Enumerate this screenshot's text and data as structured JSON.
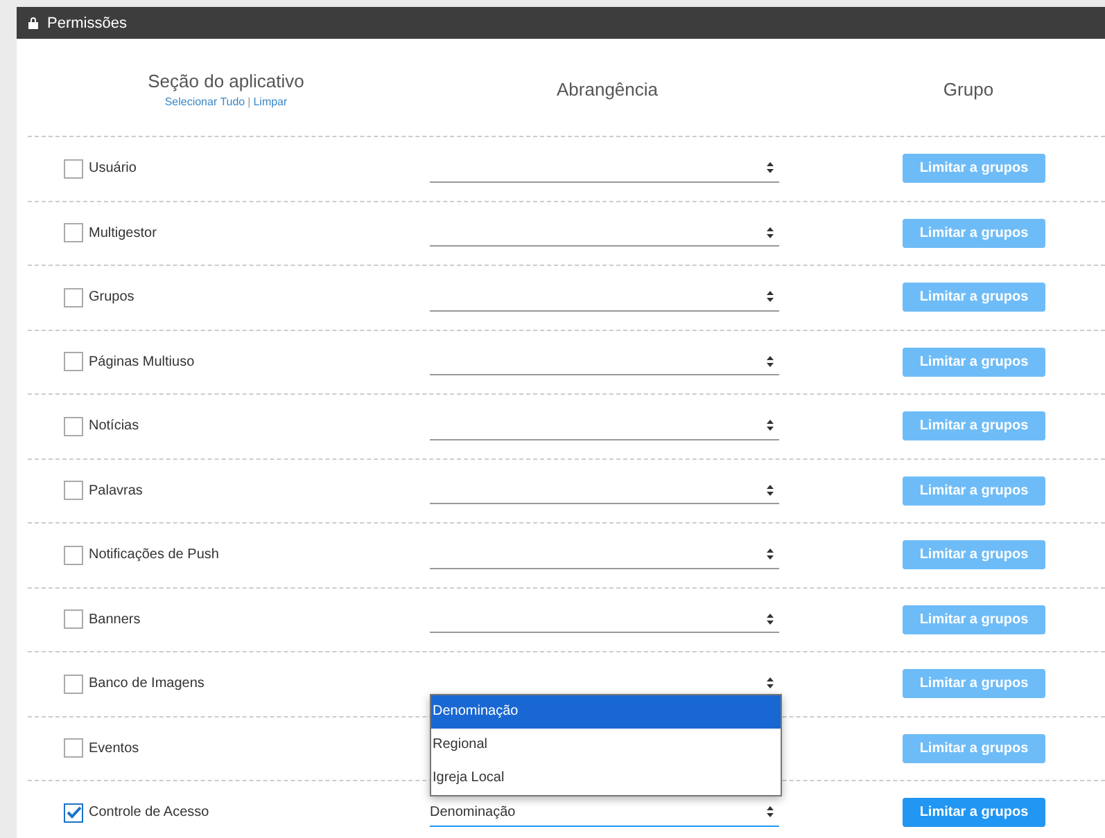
{
  "panel": {
    "title": "Permissões"
  },
  "columns": [
    "Seção do aplicativo",
    "Abrangência",
    "Grupo"
  ],
  "select_links": [
    "Selecionar Tudo",
    "Limpar"
  ],
  "link_separator": "|",
  "rows": [
    {
      "section": "Usuário",
      "checked": false,
      "scope": "",
      "button": "Limitar a grupos",
      "disabled": true
    },
    {
      "section": "Multigestor",
      "checked": false,
      "scope": "",
      "button": "Limitar a grupos",
      "disabled": true
    },
    {
      "section": "Grupos",
      "checked": false,
      "scope": "",
      "button": "Limitar a grupos",
      "disabled": true
    },
    {
      "section": "Páginas Multiuso",
      "checked": false,
      "scope": "",
      "button": "Limitar a grupos",
      "disabled": true
    },
    {
      "section": "Notícias",
      "checked": false,
      "scope": "",
      "button": "Limitar a grupos",
      "disabled": true
    },
    {
      "section": "Palavras",
      "checked": false,
      "scope": "",
      "button": "Limitar a grupos",
      "disabled": true
    },
    {
      "section": "Notificações de Push",
      "checked": false,
      "scope": "",
      "button": "Limitar a grupos",
      "disabled": true
    },
    {
      "section": "Banners",
      "checked": false,
      "scope": "",
      "button": "Limitar a grupos",
      "disabled": true
    },
    {
      "section": "Banco de Imagens",
      "checked": false,
      "scope": "",
      "button": "Limitar a grupos",
      "disabled": true
    },
    {
      "section": "Eventos",
      "checked": false,
      "button": "Limitar a grupos",
      "disabled": true,
      "select_covered": true
    },
    {
      "section": "Controle de Acesso",
      "checked": true,
      "scope": "Denominação",
      "button": "Limitar a grupos",
      "disabled": false,
      "focused": true,
      "options": [
        {
          "label": "Denominação",
          "selected": true
        },
        {
          "label": "Regional",
          "selected": false
        },
        {
          "label": "Igreja Local",
          "selected": false
        }
      ]
    }
  ]
}
